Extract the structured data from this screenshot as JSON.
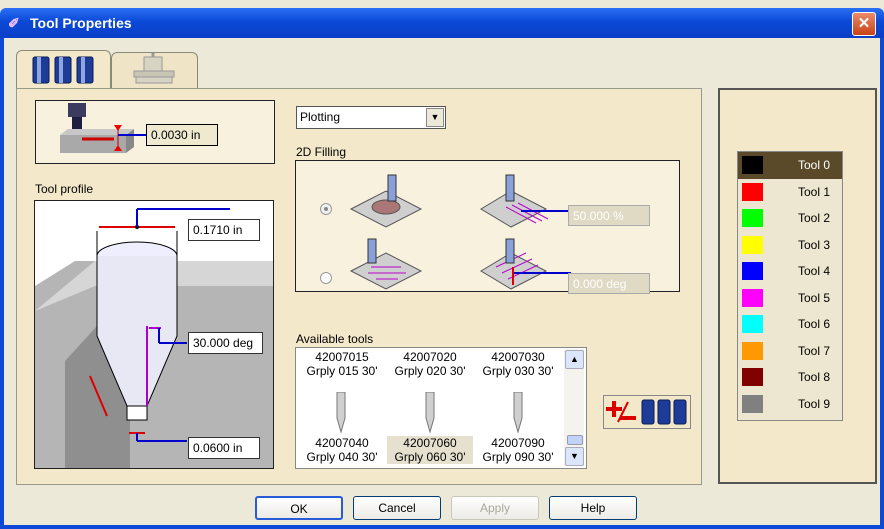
{
  "window": {
    "title": "Tool Properties",
    "close": "✕"
  },
  "tabs": [
    "tools-tab",
    "machine-tab"
  ],
  "tool_offset": {
    "value": "0.0030 in"
  },
  "tool_profile": {
    "label": "Tool profile",
    "diameter": "0.1710 in",
    "angle": "30.000 deg",
    "tip": "0.0600 in"
  },
  "mode_select": {
    "value": "Plotting"
  },
  "filling": {
    "label": "2D Filling",
    "overlap": "50.000 %",
    "angle": "0.000 deg"
  },
  "available_tools": {
    "label": "Available tools",
    "rows": [
      [
        {
          "code": "42007015",
          "name": "Grply 015 30'"
        },
        {
          "code": "42007020",
          "name": "Grply 020 30'"
        },
        {
          "code": "42007030",
          "name": "Grply 030 30'"
        }
      ],
      [
        {
          "code": "42007040",
          "name": "Grply 040 30'"
        },
        {
          "code": "42007060",
          "name": "Grply 060 30'"
        },
        {
          "code": "42007090",
          "name": "Grply 090 30'"
        }
      ]
    ]
  },
  "colors": {
    "items": [
      {
        "label": "Tool 0",
        "color": "#000000"
      },
      {
        "label": "Tool 1",
        "color": "#ff0000"
      },
      {
        "label": "Tool 2",
        "color": "#00ff00"
      },
      {
        "label": "Tool 3",
        "color": "#ffff00"
      },
      {
        "label": "Tool 4",
        "color": "#0000ff"
      },
      {
        "label": "Tool 5",
        "color": "#ff00ff"
      },
      {
        "label": "Tool 6",
        "color": "#00ffff"
      },
      {
        "label": "Tool 7",
        "color": "#ff9900"
      },
      {
        "label": "Tool 8",
        "color": "#800000"
      },
      {
        "label": "Tool 9",
        "color": "#808080"
      }
    ],
    "selected_bg": "#5a4a2a"
  },
  "buttons": {
    "ok": "OK",
    "cancel": "Cancel",
    "apply": "Apply",
    "help": "Help"
  }
}
